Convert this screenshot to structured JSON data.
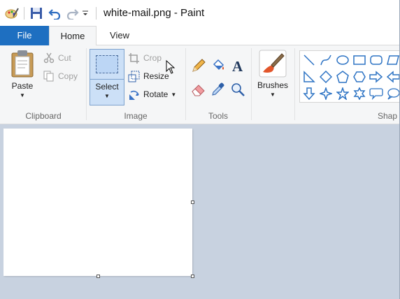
{
  "window": {
    "title": "white-mail.png - Paint"
  },
  "quick_access": {
    "icons": [
      "paint-app-icon",
      "save-icon",
      "undo-icon",
      "redo-icon",
      "customize-dropdown-icon"
    ]
  },
  "tabs": [
    {
      "label": "File",
      "active": false
    },
    {
      "label": "Home",
      "active": true
    },
    {
      "label": "View",
      "active": false
    }
  ],
  "ribbon": {
    "clipboard": {
      "label": "Clipboard",
      "paste": "Paste",
      "cut": "Cut",
      "copy": "Copy"
    },
    "image": {
      "label": "Image",
      "select": "Select",
      "crop": "Crop",
      "resize": "Resize",
      "rotate": "Rotate"
    },
    "tools": {
      "label": "Tools"
    },
    "brushes": {
      "label": "Brushes"
    },
    "shapes": {
      "label": "Shap"
    }
  },
  "colors": {
    "accent": "#1e6fc1",
    "ribbon_bg": "#f5f6f7",
    "workspace_bg": "#c8d2e0",
    "select_active": "#cce0f7"
  }
}
